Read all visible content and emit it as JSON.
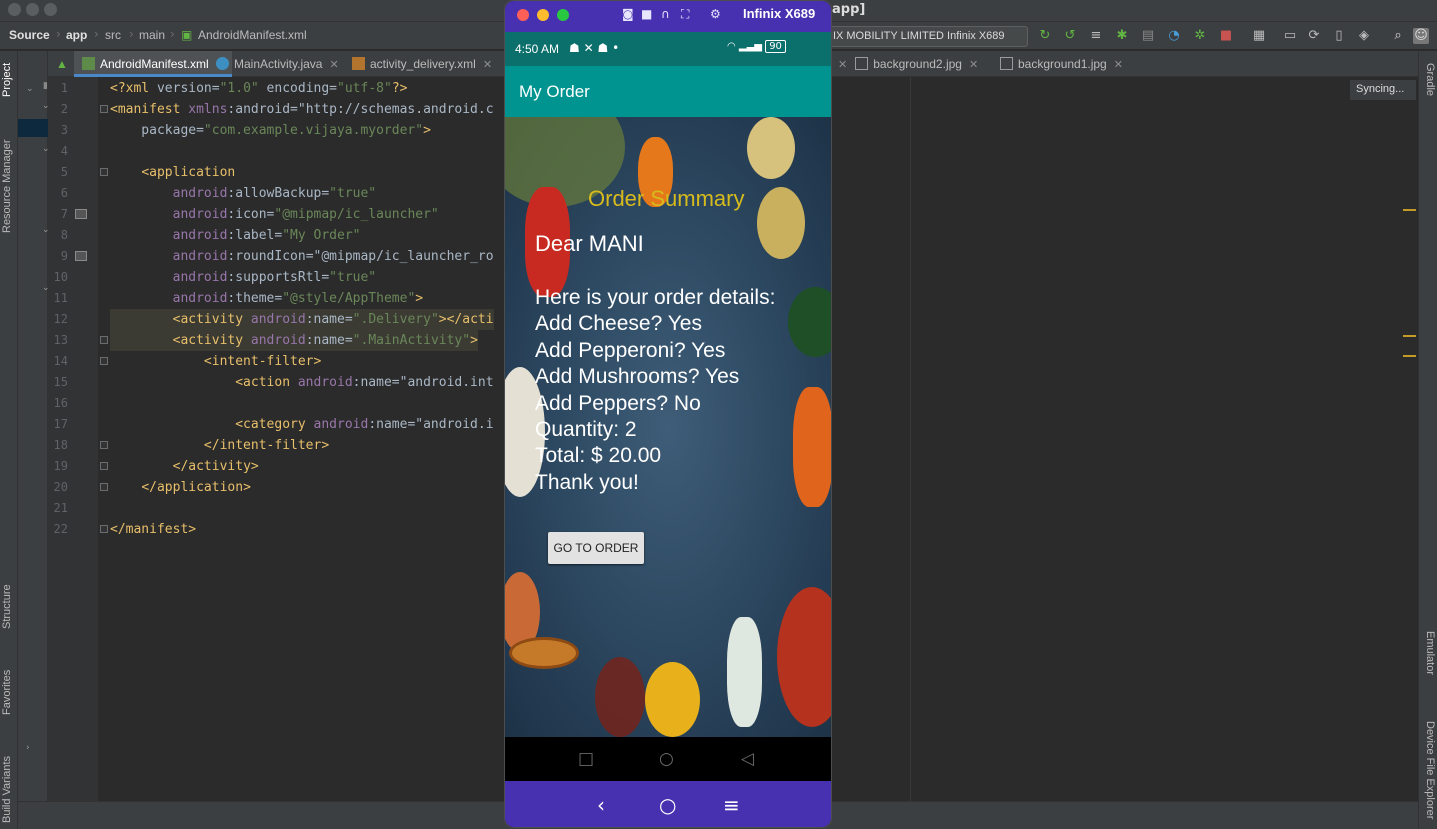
{
  "window": {
    "title": "app]"
  },
  "breadcrumb": [
    "Source",
    "app",
    "src",
    "main",
    "AndroidManifest.xml"
  ],
  "device_selector": "NIX MOBILITY LIMITED Infinix X689",
  "tool_windows_left": [
    "Project",
    "Resource Manager",
    "Structure",
    "Favorites",
    "Build Variants"
  ],
  "tool_windows_right": [
    "Gradle",
    "Emulator",
    "Device File Explorer"
  ],
  "tabs": [
    {
      "label": "AndroidManifest.xml",
      "icon": "android-manifest-icon",
      "active": true
    },
    {
      "label": "MainActivity.java",
      "icon": "java-class-icon",
      "active": false
    },
    {
      "label": "activity_delivery.xml",
      "icon": "layout-xml-icon",
      "active": false
    },
    {
      "label": "background2.jpg",
      "icon": "image-file-icon",
      "active": false
    },
    {
      "label": "background1.jpg",
      "icon": "image-file-icon",
      "active": false
    }
  ],
  "sync_status": "Syncing...",
  "code_lines": [
    {
      "n": "1",
      "text": "<?xml version=\"1.0\" encoding=\"utf-8\"?>"
    },
    {
      "n": "2",
      "text": "<manifest xmlns:android=\"http://schemas.android.c"
    },
    {
      "n": "3",
      "text": "    package=\"com.example.vijaya.myorder\">"
    },
    {
      "n": "4",
      "text": ""
    },
    {
      "n": "5",
      "text": "    <application"
    },
    {
      "n": "6",
      "text": "        android:allowBackup=\"true\""
    },
    {
      "n": "7",
      "text": "        android:icon=\"@mipmap/ic_launcher\""
    },
    {
      "n": "8",
      "text": "        android:label=\"My Order\""
    },
    {
      "n": "9",
      "text": "        android:roundIcon=\"@mipmap/ic_launcher_ro"
    },
    {
      "n": "10",
      "text": "        android:supportsRtl=\"true\""
    },
    {
      "n": "11",
      "text": "        android:theme=\"@style/AppTheme\">"
    },
    {
      "n": "12",
      "text": "        <activity android:name=\".Delivery\"></acti"
    },
    {
      "n": "13",
      "text": "        <activity android:name=\".MainActivity\">"
    },
    {
      "n": "14",
      "text": "            <intent-filter>"
    },
    {
      "n": "15",
      "text": "                <action android:name=\"android.int"
    },
    {
      "n": "16",
      "text": ""
    },
    {
      "n": "17",
      "text": "                <category android:name=\"android.i"
    },
    {
      "n": "18",
      "text": "            </intent-filter>"
    },
    {
      "n": "19",
      "text": "        </activity>"
    },
    {
      "n": "20",
      "text": "    </application>"
    },
    {
      "n": "21",
      "text": ""
    },
    {
      "n": "22",
      "text": "</manifest>"
    }
  ],
  "emulator": {
    "device_name": "Infinix X689",
    "status_time": "4:50 AM",
    "status_battery": "90",
    "app_title": "My Order",
    "order_summary_title": "Order Summary",
    "greeting": "Dear MANI",
    "details": [
      "Here is your order details:",
      "Add Cheese? Yes",
      "Add Pepperoni? Yes",
      "Add Mushrooms? Yes",
      "Add Peppers? No",
      "Quantity: 2",
      "Total: $ 20.00",
      "Thank you!"
    ],
    "button_label": "GO TO ORDER",
    "colors": {
      "header": "#4731b0",
      "status_bar": "#0b6f6c",
      "app_bar": "#009490",
      "summary_title": "#d7bb1c"
    }
  }
}
